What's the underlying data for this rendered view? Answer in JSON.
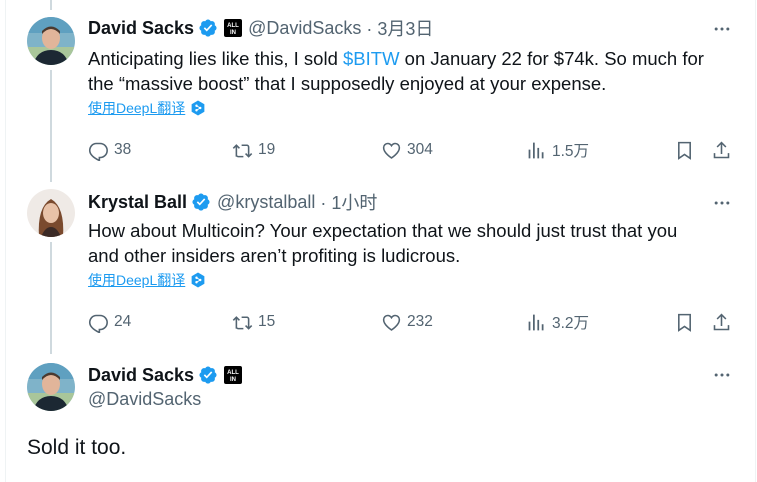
{
  "tweets": [
    {
      "name": "David Sacks",
      "handle": "@DavidSacks",
      "time": "· 3月3日",
      "affiliate_badge": "ALL IN",
      "text_line1_pre": "Anticipating lies like this, I sold ",
      "cashtag": "$BITW",
      "text_line1_post": " on January 22 for $74k. So much for",
      "text_line2": "the “massive boost” that I supposedly enjoyed at your expense.",
      "translate": "使用DeepL翻译",
      "replies": "38",
      "retweets": "19",
      "likes": "304",
      "views": "1.5万"
    },
    {
      "name": "Krystal Ball",
      "handle": "@krystalball",
      "time": "· 1小时",
      "text_line1": "How about Multicoin? Your expectation that we should just trust that you",
      "text_line2": "and other insiders aren’t profiting is ludicrous.",
      "translate": "使用DeepL翻译",
      "replies": "24",
      "retweets": "15",
      "likes": "232",
      "views": "3.2万"
    }
  ],
  "main_tweet": {
    "name": "David Sacks",
    "handle": "@DavidSacks",
    "affiliate_badge": "ALL IN",
    "text": "Sold it too."
  },
  "colors": {
    "accent": "#1d9bf0",
    "secondary_text": "#536471",
    "thread_line": "#cfd9de"
  }
}
